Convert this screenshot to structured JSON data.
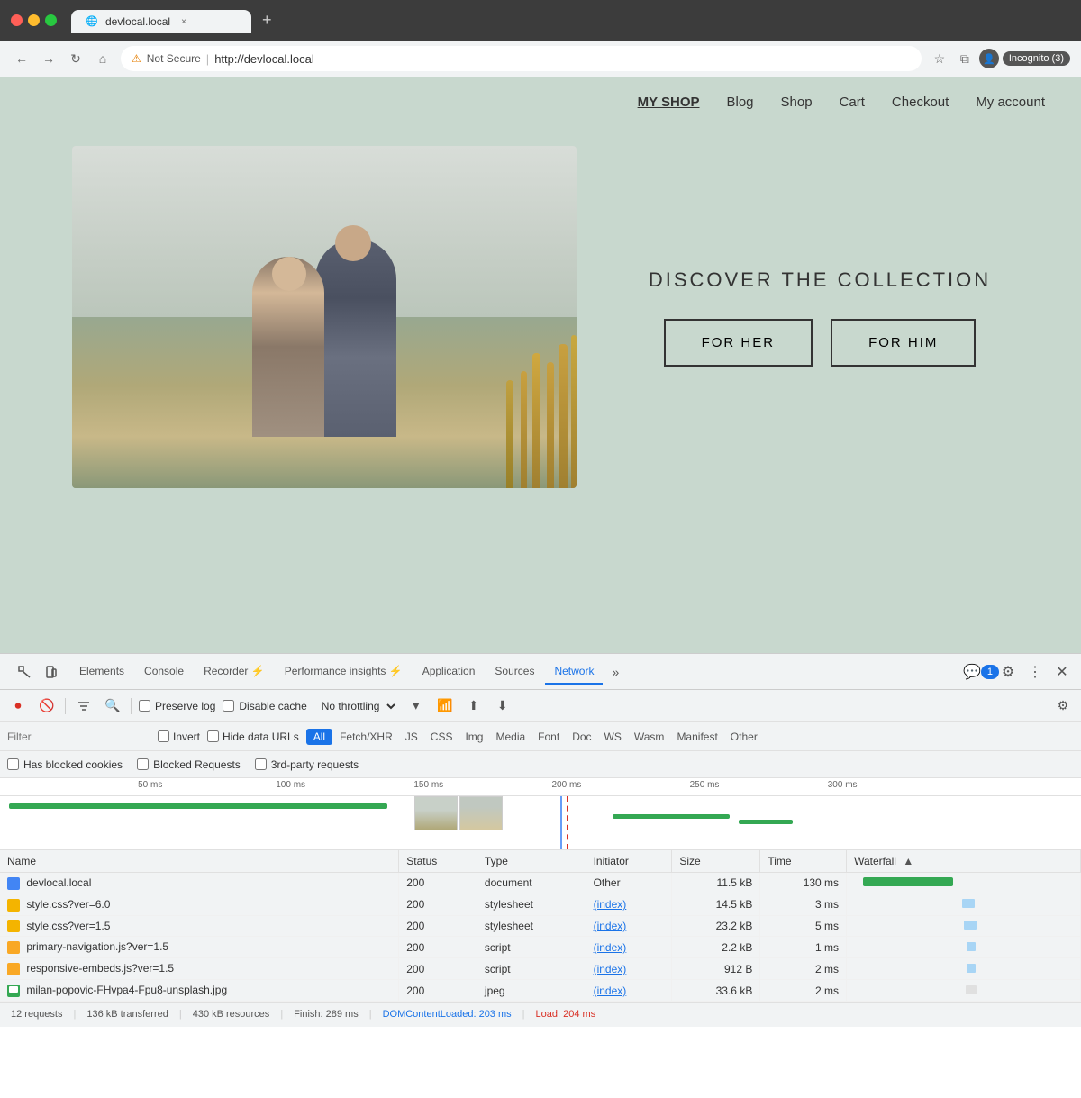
{
  "browser": {
    "tab_title": "devlocal.local",
    "tab_favicon": "🌐",
    "address_bar": {
      "security_icon": "⚠",
      "security_text": "Not Secure",
      "url": "http://devlocal.local"
    },
    "incognito_label": "Incognito (3)"
  },
  "site": {
    "nav": {
      "brand": "MY SHOP",
      "links": [
        "Blog",
        "Shop",
        "Cart",
        "Checkout",
        "My account"
      ]
    },
    "hero": {
      "title": "DISCOVER THE COLLECTION",
      "btn_her": "FOR HER",
      "btn_him": "FOR HIM"
    }
  },
  "devtools": {
    "tabs": [
      {
        "label": "Elements",
        "active": false
      },
      {
        "label": "Console",
        "active": false
      },
      {
        "label": "Recorder ⚡",
        "active": false
      },
      {
        "label": "Performance insights ⚡",
        "active": false
      },
      {
        "label": "Application",
        "active": false
      },
      {
        "label": "Sources",
        "active": false
      },
      {
        "label": "Network",
        "active": true
      }
    ],
    "more_tabs": "»",
    "chat_badge": "1",
    "toolbar": {
      "preserve_log": "Preserve log",
      "disable_cache": "Disable cache",
      "throttle": "No throttling"
    },
    "filter_bar": {
      "placeholder": "Filter",
      "invert": "Invert",
      "hide_data": "Hide data URLs",
      "filter_all": "All",
      "filter_types": [
        "Fetch/XHR",
        "JS",
        "CSS",
        "Img",
        "Media",
        "Font",
        "Doc",
        "WS",
        "Wasm",
        "Manifest",
        "Other"
      ]
    },
    "cookies_bar": {
      "has_blocked": "Has blocked cookies",
      "blocked_requests": "Blocked Requests",
      "third_party": "3rd-party requests"
    },
    "timeline": {
      "marks": [
        "50 ms",
        "100 ms",
        "150 ms",
        "200 ms",
        "250 ms",
        "300 ms"
      ]
    },
    "table": {
      "headers": [
        "Name",
        "Status",
        "Type",
        "Initiator",
        "Size",
        "Time",
        "Waterfall"
      ],
      "rows": [
        {
          "icon": "doc",
          "name": "devlocal.local",
          "status": "200",
          "type": "document",
          "initiator": "Other",
          "initiator_link": false,
          "size": "11.5 kB",
          "time": "130 ms",
          "wf_type": "green_long"
        },
        {
          "icon": "css",
          "name": "style.css?ver=6.0",
          "status": "200",
          "type": "stylesheet",
          "initiator": "(index)",
          "initiator_link": true,
          "size": "14.5 kB",
          "time": "3 ms",
          "wf_type": "blue_short"
        },
        {
          "icon": "css",
          "name": "style.css?ver=1.5",
          "status": "200",
          "type": "stylesheet",
          "initiator": "(index)",
          "initiator_link": true,
          "size": "23.2 kB",
          "time": "5 ms",
          "wf_type": "blue_short"
        },
        {
          "icon": "js",
          "name": "primary-navigation.js?ver=1.5",
          "status": "200",
          "type": "script",
          "initiator": "(index)",
          "initiator_link": true,
          "size": "2.2 kB",
          "time": "1 ms",
          "wf_type": "blue_tiny"
        },
        {
          "icon": "js",
          "name": "responsive-embeds.js?ver=1.5",
          "status": "200",
          "type": "script",
          "initiator": "(index)",
          "initiator_link": true,
          "size": "912 B",
          "time": "2 ms",
          "wf_type": "blue_tiny"
        },
        {
          "icon": "img",
          "name": "milan-popovic-FHvpa4-Fpu8-unsplash.jpg",
          "status": "200",
          "type": "jpeg",
          "initiator": "(index)",
          "initiator_link": true,
          "size": "33.6 kB",
          "time": "2 ms",
          "wf_type": "gray_tiny"
        }
      ]
    },
    "status_bar": {
      "requests": "12 requests",
      "transferred": "136 kB transferred",
      "resources": "430 kB resources",
      "finish": "Finish: 289 ms",
      "dom_loaded": "DOMContentLoaded: 203 ms",
      "load": "Load: 204 ms"
    }
  }
}
